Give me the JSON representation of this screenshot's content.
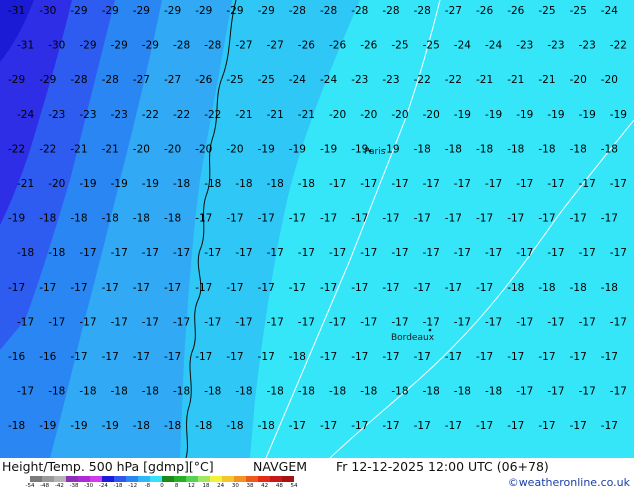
{
  "map": {
    "colors": {
      "c31": "#1b1bd6",
      "c29": "#2e2ee6",
      "c26": "#2f5cf0",
      "c24": "#2a86f2",
      "c21": "#31a9f5",
      "c19": "#2fc8f6",
      "c17": "#35e6f9",
      "contour": "#ffffff",
      "coast": "#0b0b0b"
    },
    "places": [
      {
        "id": "paris",
        "name": "Paris"
      },
      {
        "id": "bordeaux",
        "name": "Bordeaux"
      }
    ],
    "labels": [
      "-31",
      "-30",
      "-29",
      "-29",
      "-29",
      "-29",
      "-29",
      "-29",
      "-29",
      "-28",
      "-28",
      "-28",
      "-28",
      "-28",
      "-27",
      "-26",
      "-26",
      "-25",
      "-25",
      "-24",
      "-31",
      "-30",
      "-29",
      "-29",
      "-29",
      "-28",
      "-28",
      "-27",
      "-27",
      "-26",
      "-26",
      "-26",
      "-25",
      "-25",
      "-24",
      "-24",
      "-23",
      "-23",
      "-23",
      "-22",
      "-29",
      "-29",
      "-28",
      "-28",
      "-27",
      "-27",
      "-26",
      "-25",
      "-25",
      "-24",
      "-24",
      "-23",
      "-23",
      "-22",
      "-22",
      "-21",
      "-21",
      "-21",
      "-20",
      "-20",
      "-24",
      "-23",
      "-23",
      "-23",
      "-22",
      "-22",
      "-22",
      "-21",
      "-21",
      "-21",
      "-20",
      "-20",
      "-20",
      "-20",
      "-19",
      "-19",
      "-19",
      "-19",
      "-19",
      "-19",
      "-22",
      "-22",
      "-21",
      "-21",
      "-20",
      "-20",
      "-20",
      "-20",
      "-19",
      "-19",
      "-19",
      "-19",
      "-19",
      "-18",
      "-18",
      "-18",
      "-18",
      "-18",
      "-18",
      "-18",
      "-21",
      "-20",
      "-19",
      "-19",
      "-19",
      "-18",
      "-18",
      "-18",
      "-18",
      "-18",
      "-17",
      "-17",
      "-17",
      "-17",
      "-17",
      "-17",
      "-17",
      "-17",
      "-17",
      "-17",
      "-19",
      "-18",
      "-18",
      "-18",
      "-18",
      "-18",
      "-17",
      "-17",
      "-17",
      "-17",
      "-17",
      "-17",
      "-17",
      "-17",
      "-17",
      "-17",
      "-17",
      "-17",
      "-17",
      "-17",
      "-18",
      "-18",
      "-17",
      "-17",
      "-17",
      "-17",
      "-17",
      "-17",
      "-17",
      "-17",
      "-17",
      "-17",
      "-17",
      "-17",
      "-17",
      "-17",
      "-17",
      "-17",
      "-17",
      "-17",
      "-17",
      "-17",
      "-17",
      "-17",
      "-17",
      "-17",
      "-17",
      "-17",
      "-17",
      "-17",
      "-17",
      "-17",
      "-17",
      "-17",
      "-17",
      "-17",
      "-18",
      "-18",
      "-18",
      "-18",
      "-17",
      "-17",
      "-17",
      "-17",
      "-17",
      "-17",
      "-17",
      "-17",
      "-17",
      "-17",
      "-17",
      "-17",
      "-17",
      "-17",
      "-17",
      "-17",
      "-17",
      "-17",
      "-17",
      "-17",
      "-16",
      "-16",
      "-17",
      "-17",
      "-17",
      "-17",
      "-17",
      "-17",
      "-17",
      "-18",
      "-17",
      "-17",
      "-17",
      "-17",
      "-17",
      "-17",
      "-17",
      "-17",
      "-17",
      "-17",
      "-17",
      "-18",
      "-18",
      "-18",
      "-18",
      "-18",
      "-18",
      "-18",
      "-18",
      "-18",
      "-18",
      "-18",
      "-18",
      "-18",
      "-18",
      "-18",
      "-17",
      "-17",
      "-17",
      "-17",
      "-18",
      "-19",
      "-19",
      "-19",
      "-18",
      "-18",
      "-18",
      "-18",
      "-18",
      "-17",
      "-17",
      "-17",
      "-17",
      "-17",
      "-17",
      "-17",
      "-17",
      "-17",
      "-17",
      "-17"
    ]
  },
  "footer": {
    "title": "Height/Temp. 500 hPa [gdmp][°C]",
    "model": "NAVGEM",
    "validtime": "Fr 12-12-2025 12:00 UTC (06+78)",
    "copyright": "©weatheronline.co.uk",
    "colorbar": {
      "colors": [
        "#7a7a7a",
        "#9a9a9a",
        "#b4b4b4",
        "#8d2fb7",
        "#b02bd8",
        "#d13aed",
        "#1c1ce0",
        "#2f56ee",
        "#2b86f2",
        "#2fb8f6",
        "#35e2f9",
        "#1b8a1b",
        "#27b027",
        "#55d255",
        "#a0e860",
        "#f2f238",
        "#f2c62d",
        "#f29424",
        "#ee5a1c",
        "#e42a18",
        "#c61818",
        "#a51212"
      ],
      "ticks": [
        "-54",
        "-48",
        "-42",
        "-38",
        "-30",
        "-24",
        "-18",
        "-12",
        "-8",
        "0",
        "8",
        "12",
        "18",
        "24",
        "30",
        "38",
        "42",
        "48",
        "54"
      ]
    }
  }
}
